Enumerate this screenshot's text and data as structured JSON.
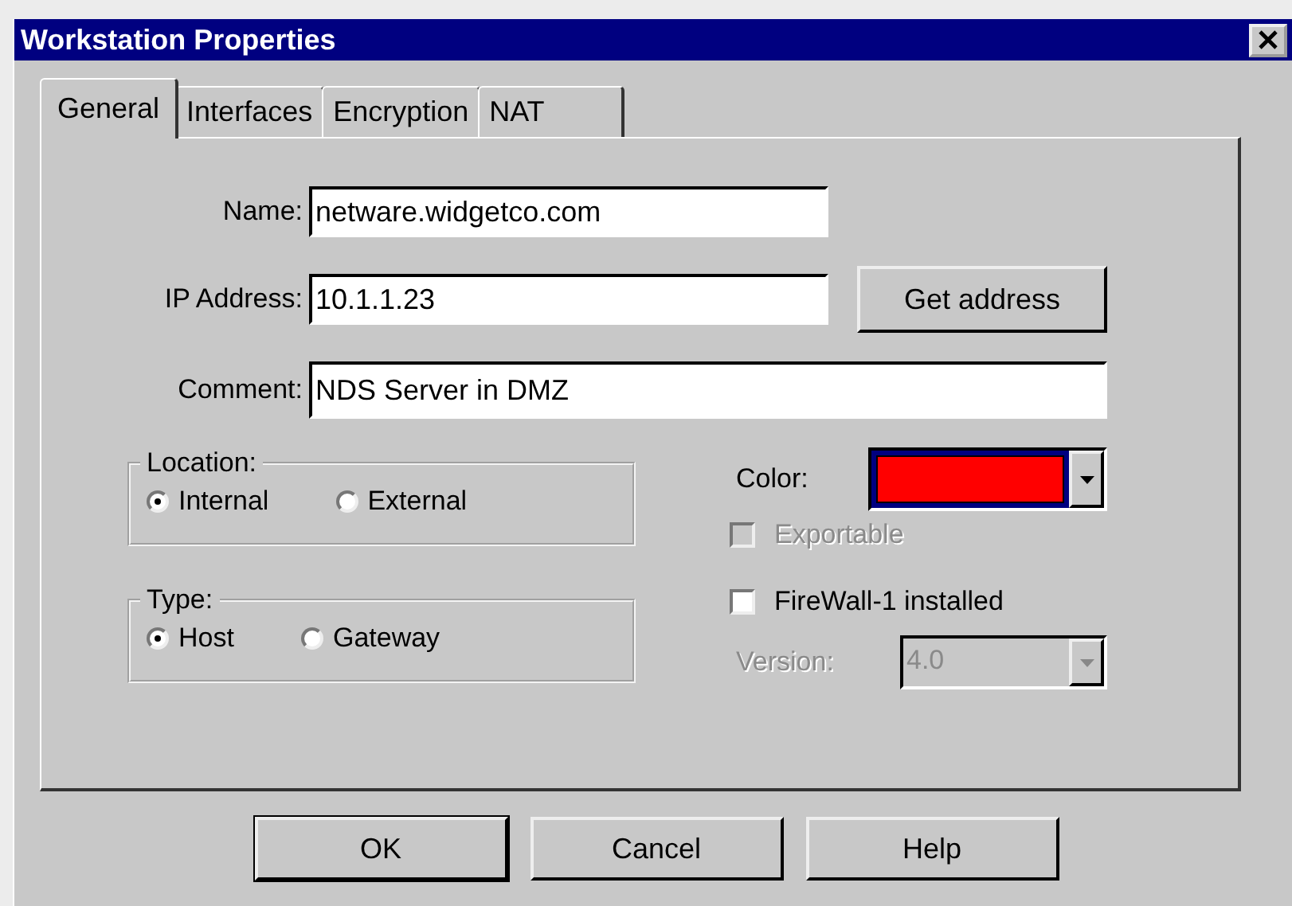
{
  "window": {
    "title": "Workstation Properties"
  },
  "tabs": [
    {
      "label": "General",
      "selected": true
    },
    {
      "label": "Interfaces",
      "selected": false
    },
    {
      "label": "Encryption",
      "selected": false
    },
    {
      "label": "NAT",
      "selected": false
    }
  ],
  "fields": [
    {
      "kind": "text",
      "label": "Name:",
      "value": "netware.widgetco.com"
    },
    {
      "kind": "text_button",
      "label": "IP Address:",
      "value": "10.1.1.23",
      "button": "Get address"
    },
    {
      "kind": "wide",
      "label": "Comment:",
      "value": "NDS Server in DMZ"
    }
  ],
  "groups": [
    {
      "title": "Location:",
      "options": [
        {
          "label": "Internal",
          "selected": true
        },
        {
          "label": "External",
          "selected": false
        }
      ]
    },
    {
      "title": "Type:",
      "options": [
        {
          "label": "Host",
          "selected": true
        },
        {
          "label": "Gateway",
          "selected": false
        }
      ]
    }
  ],
  "color": {
    "label": "Color:",
    "color": "#ff0000"
  },
  "checkboxes": [
    {
      "label": "Exportable",
      "checked": false,
      "disabled": true
    },
    {
      "label": "FireWall-1 installed",
      "checked": false,
      "disabled": false
    }
  ],
  "version": {
    "label": "Version:",
    "value": "4.0",
    "disabled": true
  },
  "buttons": [
    {
      "label": "OK",
      "default": true
    },
    {
      "label": "Cancel",
      "default": false
    },
    {
      "label": "Help",
      "default": false
    }
  ]
}
